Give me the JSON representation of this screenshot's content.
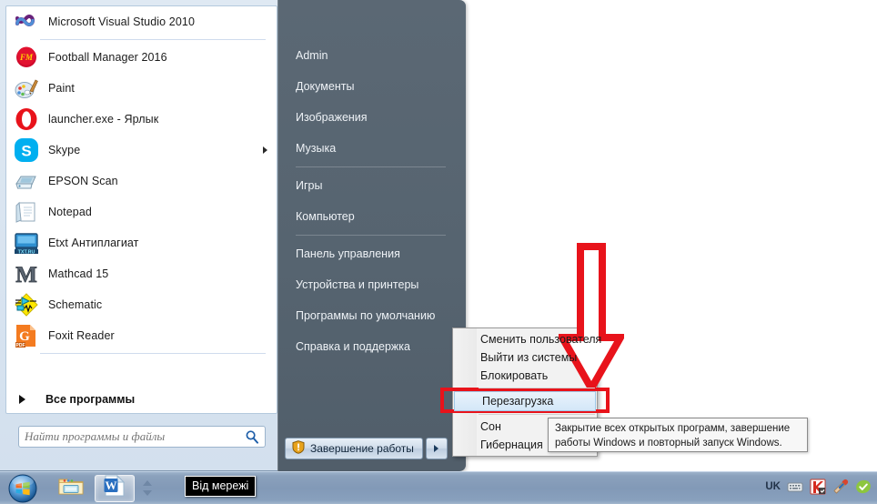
{
  "start_menu": {
    "programs": [
      {
        "label": "Microsoft Visual Studio 2010",
        "icon": "visual-studio-icon",
        "submenu": false,
        "separator_after": true
      },
      {
        "label": "Football Manager 2016",
        "icon": "football-manager-icon",
        "submenu": false,
        "separator_after": false
      },
      {
        "label": "Paint",
        "icon": "paint-icon",
        "submenu": false,
        "separator_after": false
      },
      {
        "label": "launcher.exe - Ярлык",
        "icon": "opera-icon",
        "submenu": false,
        "separator_after": false
      },
      {
        "label": "Skype",
        "icon": "skype-icon",
        "submenu": true,
        "separator_after": false
      },
      {
        "label": "EPSON Scan",
        "icon": "epson-scan-icon",
        "submenu": false,
        "separator_after": false
      },
      {
        "label": "Notepad",
        "icon": "notepad-icon",
        "submenu": false,
        "separator_after": false
      },
      {
        "label": "Etxt Антиплагиат",
        "icon": "etxt-antiplagiat-icon",
        "submenu": false,
        "separator_after": false
      },
      {
        "label": "Mathcad 15",
        "icon": "mathcad-icon",
        "submenu": false,
        "separator_after": false
      },
      {
        "label": "Schematic",
        "icon": "schematic-icon",
        "submenu": false,
        "separator_after": false
      },
      {
        "label": "Foxit Reader",
        "icon": "foxit-reader-icon",
        "submenu": false,
        "separator_after": true
      }
    ],
    "all_programs_label": "Все программы",
    "search_placeholder": "Найти программы и файлы",
    "right_pane": [
      {
        "label": "Admin",
        "separator_after": false
      },
      {
        "label": "Документы",
        "separator_after": false
      },
      {
        "label": "Изображения",
        "separator_after": false
      },
      {
        "label": "Музыка",
        "separator_after": true
      },
      {
        "label": "Игры",
        "separator_after": false
      },
      {
        "label": "Компьютер",
        "separator_after": true
      },
      {
        "label": "Панель управления",
        "separator_after": false
      },
      {
        "label": "Устройства и принтеры",
        "separator_after": false
      },
      {
        "label": "Программы по умолчанию",
        "separator_after": false
      },
      {
        "label": "Справка и поддержка",
        "separator_after": false
      }
    ],
    "shutdown_label": "Завершение работы"
  },
  "power_menu": {
    "items": [
      {
        "label": "Сменить пользователя",
        "selected": false,
        "separator_after": false
      },
      {
        "label": "Выйти из системы",
        "selected": false,
        "separator_after": false
      },
      {
        "label": "Блокировать",
        "selected": false,
        "separator_after": true
      },
      {
        "label": "Перезагрузка",
        "selected": true,
        "separator_after": true
      },
      {
        "label": "Сон",
        "selected": false,
        "separator_after": false
      },
      {
        "label": "Гибернация",
        "selected": false,
        "separator_after": false
      }
    ],
    "tooltip": "Закрытие всех открытых программ, завершение работы Windows и повторный запуск Windows."
  },
  "annotation": {
    "color": "#e8131b",
    "arrow_direction": "down",
    "target_label": "Перезагрузка"
  },
  "taskbar": {
    "buttons": [
      {
        "name": "explorer",
        "icon": "folder-icon",
        "active": false
      },
      {
        "name": "word",
        "icon": "word-icon",
        "active": true
      }
    ],
    "network_tooltip": "Від мережі",
    "tray": {
      "language": "UK",
      "icons": [
        "keyboard-icon",
        "kaspersky-icon",
        "action-center-icon",
        "green-check-icon"
      ]
    }
  }
}
